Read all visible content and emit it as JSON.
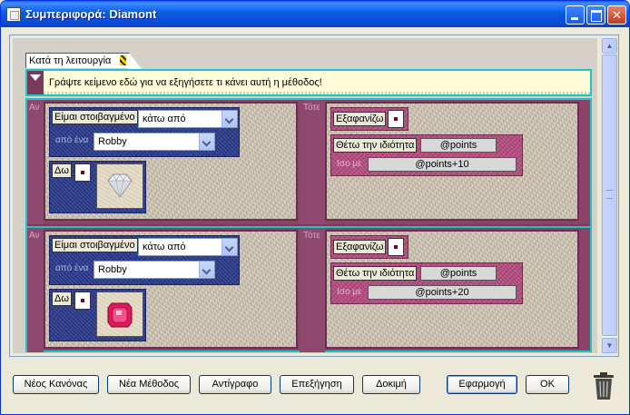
{
  "window": {
    "title": "Συμπεριφορά: Diamont"
  },
  "trigger": {
    "label": "Κατά τη λειτουργία"
  },
  "description": {
    "text": "Γράψτε κείμενο εδώ για να εξηγήσετε τι κάνει αυτή η μέθοδος!"
  },
  "rules": [
    {
      "if_label": "Αν",
      "then_label": "Τότε",
      "condition": {
        "chip": "Είμαι στοιβαγμένο",
        "position": "κάτω από",
        "of_label": "από ένα",
        "object": "Robby"
      },
      "sight": {
        "chip": "Δω",
        "icon": "diamond-icon"
      },
      "action_hide": {
        "chip": "Εξαφανίζω"
      },
      "action_set": {
        "chip": "Θέτω την ιδιότητα",
        "property": "@points",
        "equal_label": "Ισο με",
        "value": "@points+10"
      }
    },
    {
      "if_label": "Αν",
      "then_label": "Τότε",
      "condition": {
        "chip": "Είμαι στοιβαγμένο",
        "position": "κάτω από",
        "of_label": "από ένα",
        "object": "Robby"
      },
      "sight": {
        "chip": "Δω",
        "icon": "ruby-icon"
      },
      "action_hide": {
        "chip": "Εξαφανίζω"
      },
      "action_set": {
        "chip": "Θέτω την ιδιότητα",
        "property": "@points",
        "equal_label": "Ισο με",
        "value": "@points+20"
      }
    }
  ],
  "buttons": {
    "new_rule": "Νέος Κανόνας",
    "new_method": "Νέα Μέθοδος",
    "copy": "Αντίγραφο",
    "explain": "Επεξήγηση",
    "test": "Δοκιμή",
    "apply": "Εφαρμογή",
    "ok": "OK"
  },
  "colors": {
    "accent": "#1FC4C4",
    "rule_bg": "#8B4468",
    "condition_blue": "#2B3A8C",
    "action_pink": "#B44A7E"
  }
}
